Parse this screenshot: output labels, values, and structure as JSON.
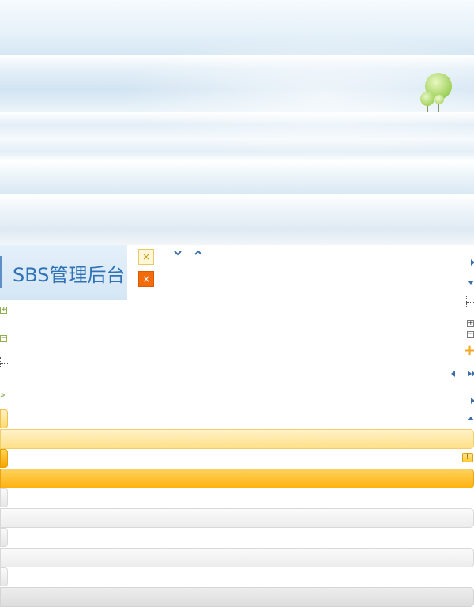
{
  "header": {
    "logo_text": "SBS管理后台"
  },
  "buttons": {
    "close_light": "×",
    "close_dark": "×",
    "chevron_down": "⌄",
    "chevron_up": "⌃"
  },
  "icons": {
    "expand_box": "+",
    "collapse_box": "−",
    "plus": "+",
    "double_arrow": "»",
    "alert": "!"
  },
  "colors": {
    "accent_blue": "#2f73b6",
    "orange": "#f26c0d",
    "yellow_bar": "#ffe088",
    "orange_bar": "#ffb20f",
    "gray_bar": "#ececec"
  }
}
